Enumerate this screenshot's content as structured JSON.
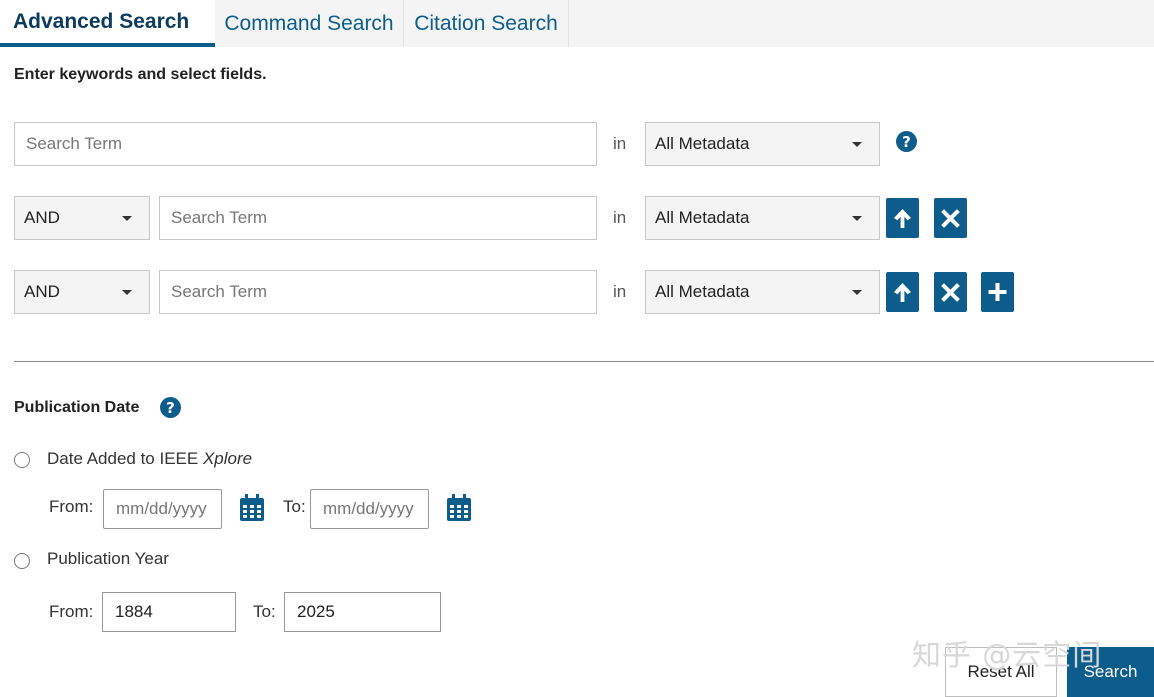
{
  "tabs": [
    {
      "label": "Advanced Search",
      "active": true
    },
    {
      "label": "Command Search",
      "active": false
    },
    {
      "label": "Citation Search",
      "active": false
    }
  ],
  "instructions": "Enter keywords and select fields.",
  "search_rows": [
    {
      "operator": null,
      "term_placeholder": "Search Term",
      "in_label": "in",
      "field": "All Metadata"
    },
    {
      "operator": "AND",
      "term_placeholder": "Search Term",
      "in_label": "in",
      "field": "All Metadata"
    },
    {
      "operator": "AND",
      "term_placeholder": "Search Term",
      "in_label": "in",
      "field": "All Metadata"
    }
  ],
  "help_glyph": "?",
  "publication_date": {
    "title": "Publication Date",
    "date_added_label": "Date Added to IEEE",
    "date_added_brand": "Xplore",
    "from_label": "From:",
    "to_label": "To:",
    "date_placeholder": "mm/dd/yyyy",
    "pub_year_label": "Publication Year",
    "year_from": "1884",
    "year_to": "2025"
  },
  "watermark": "知乎 @云空间",
  "actions": {
    "reset_label": "Reset All",
    "search_label": "Search"
  },
  "colors": {
    "accent": "#0d5d8c",
    "tab_bar": "#f4f4f4"
  }
}
